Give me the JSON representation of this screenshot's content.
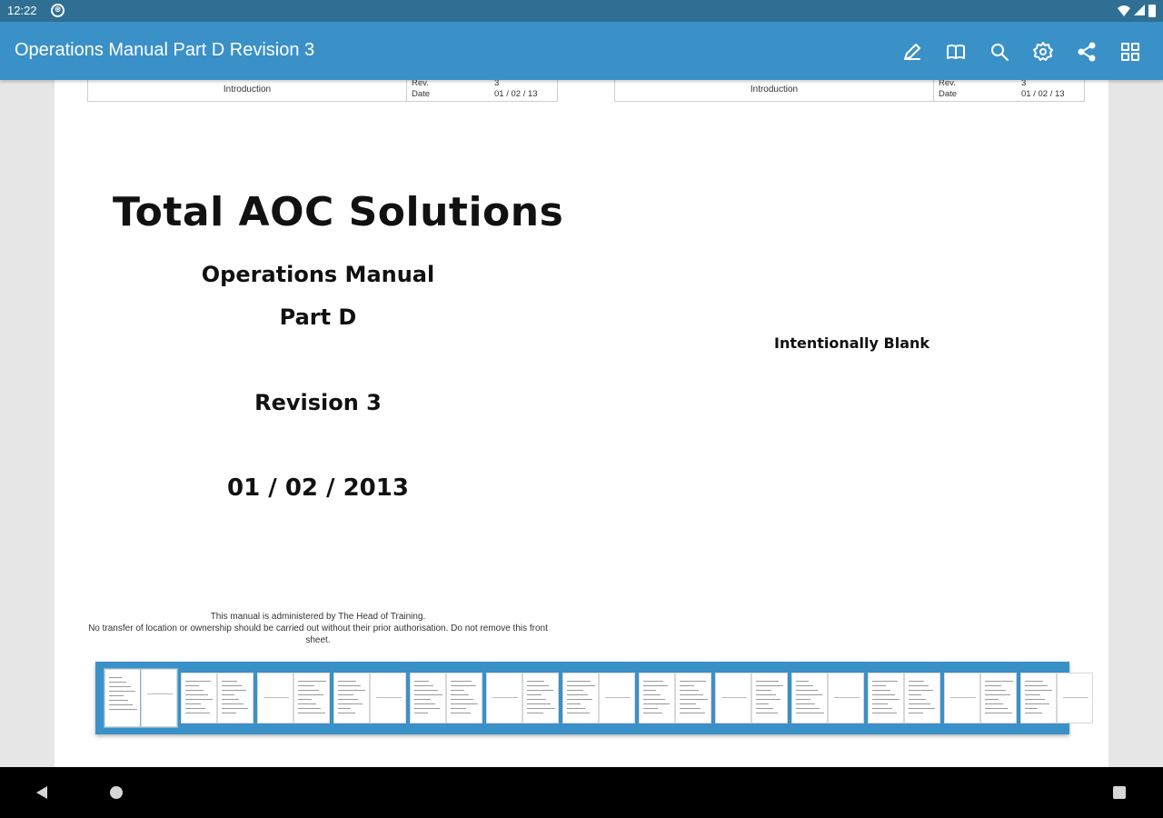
{
  "status_bar": {
    "time": "12:22",
    "notification_icon": "sync-badge-icon",
    "icons": [
      "wifi-icon",
      "cell-signal-icon",
      "battery-icon"
    ]
  },
  "app_bar": {
    "title": "Operations Manual Part D Revision 3",
    "actions": [
      "edit-pen-icon",
      "open-book-icon",
      "search-icon",
      "gear-icon",
      "share-icon",
      "grid-view-icon"
    ],
    "color": "#3a91c8"
  },
  "pages": {
    "left": {
      "header": {
        "section": "Introduction",
        "rev_label": "Rev.",
        "rev_value": "3",
        "date_label": "Date",
        "date_value": "01 / 02 / 13"
      },
      "title": "Total AOC Solutions",
      "subtitle1": "Operations Manual",
      "subtitle2": "Part D",
      "revision": "Revision 3",
      "date": "01 / 02 / 2013",
      "footer_line1": "This manual is administered by The Head of Training.",
      "footer_line2": "No transfer of location or ownership should be carried out without their prior authorisation. Do not remove this front sheet."
    },
    "right": {
      "header": {
        "section": "Introduction",
        "rev_label": "Rev.",
        "rev_value": "3",
        "date_label": "Date",
        "date_value": "01 / 02 / 13"
      },
      "note": "Intentionally Blank"
    }
  },
  "thumbnails": {
    "count": 26,
    "active_indices": [
      0,
      1
    ]
  },
  "nav_bar": {
    "buttons": [
      "back-icon",
      "home-icon",
      "recents-icon"
    ]
  }
}
